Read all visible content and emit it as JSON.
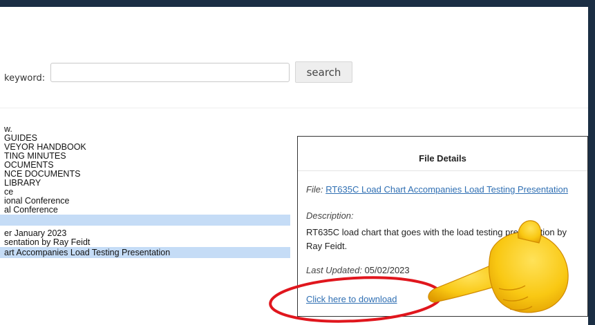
{
  "search": {
    "label": "keyword:",
    "input_value": "",
    "button_label": "search"
  },
  "tree": {
    "items": [
      {
        "label": "w."
      },
      {
        "label": "GUIDES"
      },
      {
        "label": "VEYOR HANDBOOK"
      },
      {
        "label": "TING MINUTES"
      },
      {
        "label": "OCUMENTS"
      },
      {
        "label": "NCE DOCUMENTS"
      },
      {
        "label": "LIBRARY"
      },
      {
        "label": "ce"
      },
      {
        "label": "ional Conference"
      },
      {
        "label": "al Conference"
      },
      {
        "label": ""
      },
      {
        "label": "er January 2023"
      },
      {
        "label": "sentation by Ray Feidt"
      },
      {
        "label": "art Accompanies Load Testing Presentation"
      }
    ]
  },
  "details": {
    "title": "File Details",
    "file_label": "File:",
    "file_link": "RT635C Load Chart Accompanies Load Testing Presentation",
    "description_label": "Description:",
    "description_text": "RT635C load chart that goes with the load testing presentation by Ray Feidt.",
    "updated_label": "Last Updated:",
    "updated_value": "05/02/2023",
    "download_label": "Click here to download"
  },
  "annotations": {
    "ellipse_color": "#e0161d",
    "hand_icon": "pointing-hand-emoji"
  },
  "colors": {
    "frame": "#1b2e44",
    "selection": "#c5dcf6",
    "link": "#2f6fb3"
  }
}
